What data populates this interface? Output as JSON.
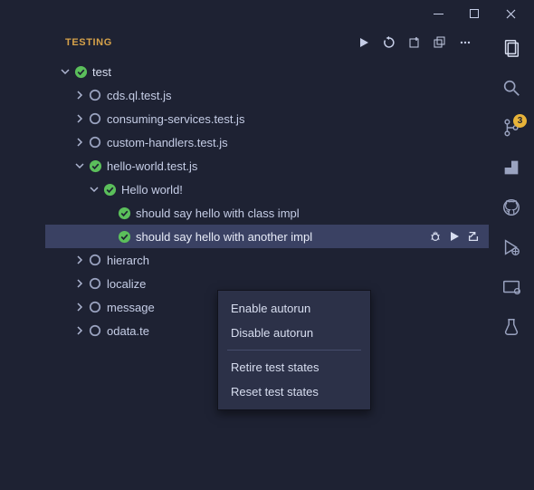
{
  "panel": {
    "title": "TESTING"
  },
  "tree": {
    "root": "test",
    "files": {
      "cds": "cds.ql.test.js",
      "consuming": "consuming-services.test.js",
      "custom": "custom-handlers.test.js",
      "hello_file": "hello-world.test.js",
      "hello_suite": "Hello world!",
      "test_class": "should say hello with class impl",
      "test_another": "should say hello with another impl",
      "hierarch": "hierarch",
      "localize": "localize",
      "message": "message",
      "odata": "odata.te"
    }
  },
  "menu": {
    "enable": "Enable autorun",
    "disable": "Disable autorun",
    "retire": "Retire test states",
    "reset": "Reset test states"
  },
  "badge": {
    "scm": "3"
  }
}
